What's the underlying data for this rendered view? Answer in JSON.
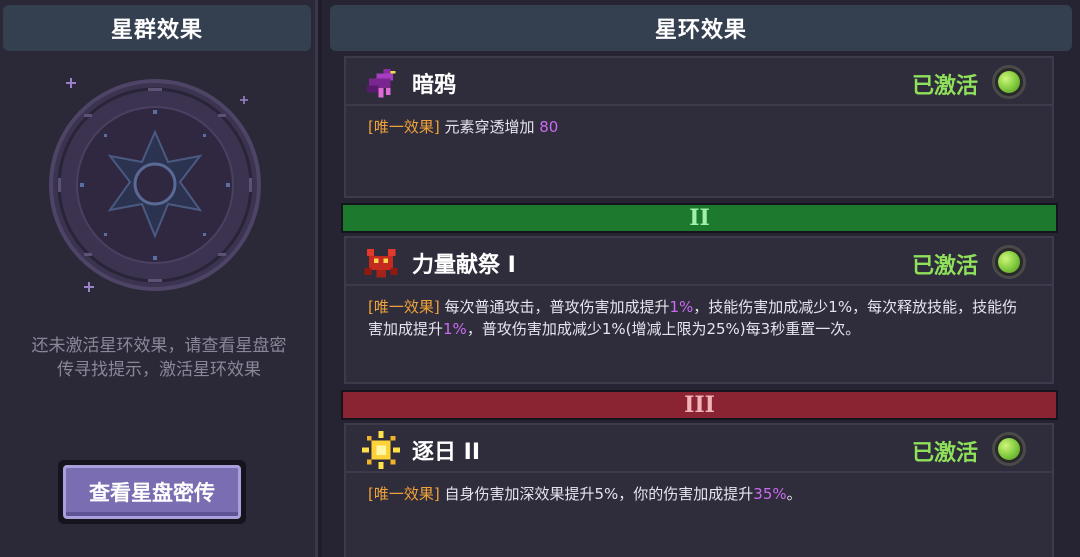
{
  "left": {
    "title": "星群效果",
    "hint_line1": "还未激活星环效果，请查看星盘密",
    "hint_line2": "传寻找提示，激活星环效果",
    "button_label": "查看星盘密传"
  },
  "right": {
    "title": "星环效果",
    "tiers": [
      "II",
      "III"
    ],
    "cards": [
      {
        "name": "暗鸦",
        "status": "已激活",
        "icon": "crow-icon",
        "tag": "[唯一效果]",
        "desc_a": " 元素穿透增加 ",
        "desc_hl": "80"
      },
      {
        "name": "力量献祭 I",
        "status": "已激活",
        "icon": "demon-crab-icon",
        "tag": "[唯一效果]",
        "p1": " 每次普通攻击，普攻伤害加成提升",
        "p1_hl": "1%",
        "p2": "，技能伤害加成减少1%，每次释放技能，技能伤害加成提升",
        "p2_hl": "1%",
        "p3": "，普攻伤害加成减少1%(增减上限为25%)每3秒重置一次。"
      },
      {
        "name": "逐日 II",
        "status": "已激活",
        "icon": "sun-icon",
        "tag": "[唯一效果]",
        "p1": " 自身伤害加深效果提升5%，你的伤害加成提升",
        "p1_hl": "35%",
        "p2": "。"
      }
    ]
  },
  "colors": {
    "active_green": "#8fe05a",
    "tag_orange": "#f0a23a",
    "highlight_purple": "#c86bf0",
    "tier2_green": "#1d7a2c",
    "tier3_red": "#8a2433"
  }
}
